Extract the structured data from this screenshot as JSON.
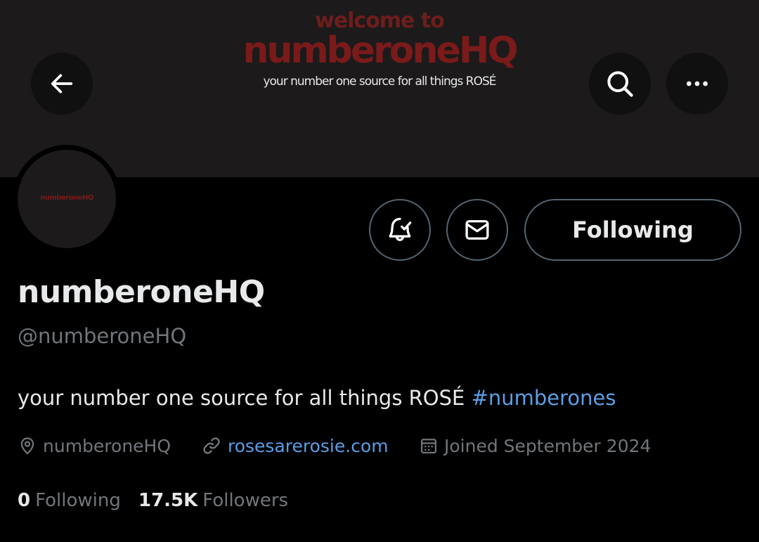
{
  "banner": {
    "welcome": "welcome to",
    "brand": "numberoneHQ",
    "tagline": "your number one source for all things ROSÉ"
  },
  "avatar": {
    "text": "numberoneHQ"
  },
  "icons": {
    "back": "arrow-left-icon",
    "search": "search-icon",
    "more": "more-horizontal-icon",
    "notify": "bell-check-icon",
    "message": "envelope-icon",
    "location": "location-pin-icon",
    "link": "link-icon",
    "calendar": "calendar-icon"
  },
  "actions": {
    "following_label": "Following"
  },
  "profile": {
    "display_name": "numberoneHQ",
    "handle": "@numberoneHQ",
    "bio_text": "your number one source for all things ROSÉ ",
    "bio_hashtag": "#numberones",
    "location": "numberoneHQ",
    "website": "rosesarerosie.com",
    "joined": "Joined September 2024"
  },
  "stats": {
    "following_count": "0",
    "following_label": "Following",
    "followers_count": "17.5K",
    "followers_label": "Followers"
  },
  "colors": {
    "background": "#000000",
    "banner": "#1c1a1a",
    "brand_red": "#7a1a1a",
    "link_blue": "#5b9ee6",
    "muted_text": "#71767b",
    "primary_text": "#e7e9ea",
    "button_border": "#536471"
  }
}
